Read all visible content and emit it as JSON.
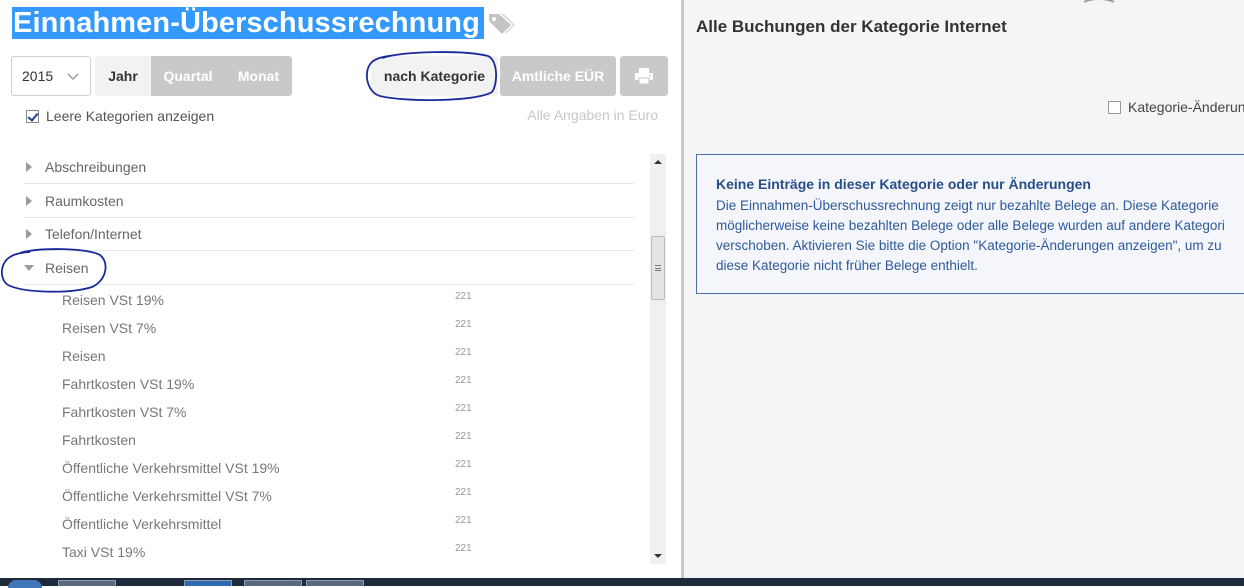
{
  "left": {
    "title": "Einnahmen-Überschussrechnung",
    "year": "2015",
    "periods": [
      "Jahr",
      "Quartal",
      "Monat"
    ],
    "active_period": "Jahr",
    "btn_kategorie": "nach Kategorie",
    "btn_amtlich": "Amtliche EÜR",
    "show_empty_label": "Leere Kategorien anzeigen",
    "show_empty_checked": true,
    "euro_note": "Alle Angaben in Euro",
    "categories": [
      {
        "label": "Abschreibungen",
        "expanded": false
      },
      {
        "label": "Raumkosten",
        "expanded": false
      },
      {
        "label": "Telefon/Internet",
        "expanded": false
      },
      {
        "label": "Reisen",
        "expanded": true
      }
    ],
    "subitems": [
      {
        "label": "Reisen VSt 19%",
        "num": "221"
      },
      {
        "label": "Reisen VSt 7%",
        "num": "221"
      },
      {
        "label": "Reisen",
        "num": "221"
      },
      {
        "label": "Fahrtkosten VSt 19%",
        "num": "221"
      },
      {
        "label": "Fahrtkosten VSt 7%",
        "num": "221"
      },
      {
        "label": "Fahrtkosten",
        "num": "221"
      },
      {
        "label": "Öffentliche Verkehrsmittel VSt 19%",
        "num": "221"
      },
      {
        "label": "Öffentliche Verkehrsmittel VSt 7%",
        "num": "221"
      },
      {
        "label": "Öffentliche Verkehrsmittel",
        "num": "221"
      },
      {
        "label": "Taxi VSt 19%",
        "num": "221"
      }
    ]
  },
  "right": {
    "title": "Alle Buchungen der Kategorie Internet",
    "show_changes_label": "Kategorie-Änderun",
    "info_title": "Keine Einträge in dieser Kategorie oder nur Änderungen",
    "info_lines": [
      "Die Einnahmen-Überschussrechnung zeigt nur bezahlte Belege an. Diese Kategorie",
      "möglicherweise keine bezahlten Belege oder alle Belege wurden auf andere Kategori",
      "verschoben. Aktivieren Sie bitte die Option \"Kategorie-Änderungen anzeigen\", um zu",
      "diese Kategorie nicht früher Belege enthielt."
    ]
  },
  "colors": {
    "title_highlight": "#3399ff",
    "annotation_ink": "#1a2a9c",
    "info_border": "#4a6fa8",
    "info_text": "#2e5a9a"
  },
  "icons": [
    "tag-icon",
    "chevron-down-icon",
    "print-icon"
  ]
}
